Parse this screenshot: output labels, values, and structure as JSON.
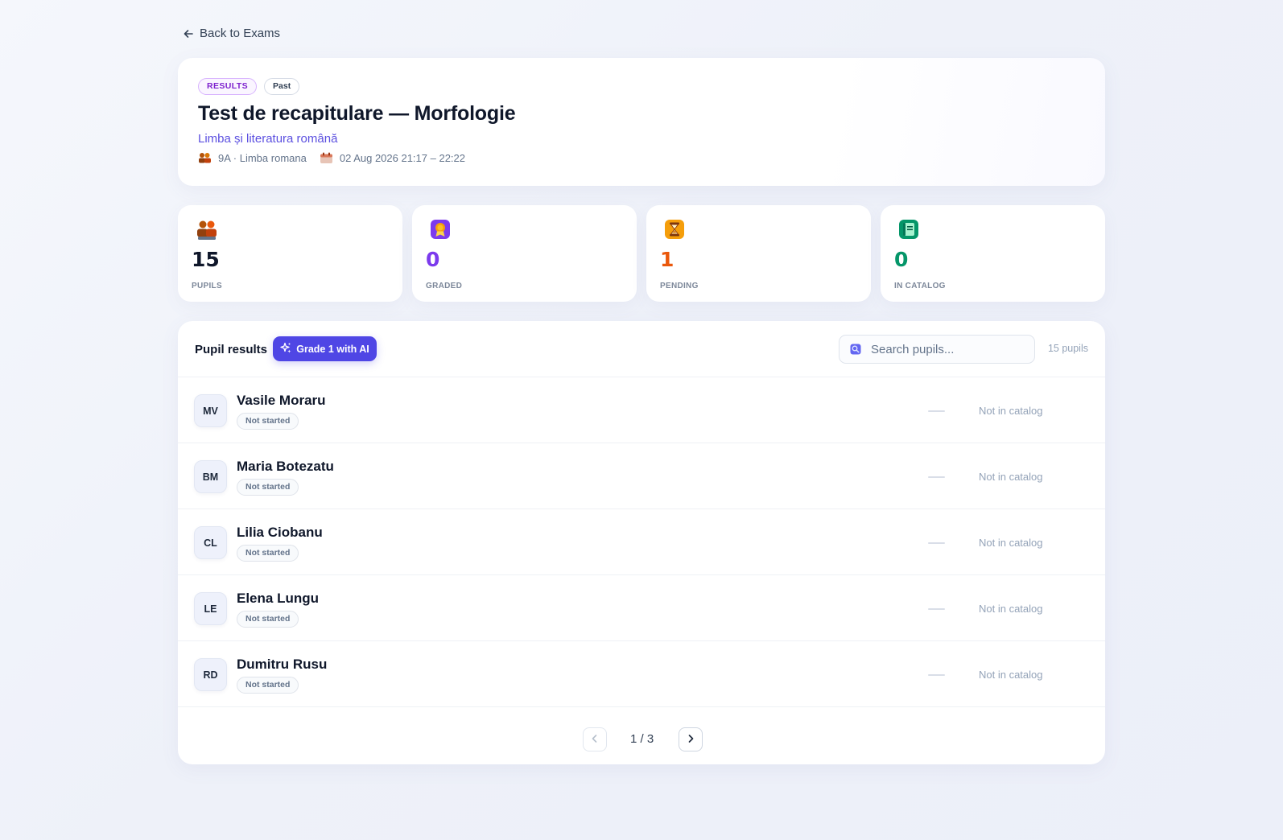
{
  "nav": {
    "back_label": "Back to Exams"
  },
  "exam": {
    "badges": {
      "results": "RESULTS",
      "past": "Past"
    },
    "title": "Test de recapitulare — Morfologie",
    "subject": "Limba și literatura română",
    "class_info": "9A · Limba romana",
    "schedule": "02 Aug 2026 21:17 – 22:22"
  },
  "stats": [
    {
      "value": "15",
      "label": "PUPILS",
      "icon": "pupils-icon",
      "color": "#0f172a"
    },
    {
      "value": "0",
      "label": "GRADED",
      "icon": "medal-icon",
      "color": "#7c3aed"
    },
    {
      "value": "1",
      "label": "PENDING",
      "icon": "hourglass-icon",
      "color": "#ea580c"
    },
    {
      "value": "0",
      "label": "IN CATALOG",
      "icon": "catalog-book-icon",
      "color": "#059669"
    }
  ],
  "results": {
    "title": "Pupil results",
    "ai_button_label": "Grade 1 with AI",
    "search_placeholder": "Search pupils...",
    "count_label": "15 pupils",
    "pupils": [
      {
        "initials": "MV",
        "name": "Vasile Moraru",
        "status": "Not started",
        "grade": "—",
        "catalog": "Not in catalog"
      },
      {
        "initials": "BM",
        "name": "Maria Botezatu",
        "status": "Not started",
        "grade": "—",
        "catalog": "Not in catalog"
      },
      {
        "initials": "CL",
        "name": "Lilia Ciobanu",
        "status": "Not started",
        "grade": "—",
        "catalog": "Not in catalog"
      },
      {
        "initials": "LE",
        "name": "Elena Lungu",
        "status": "Not started",
        "grade": "—",
        "catalog": "Not in catalog"
      },
      {
        "initials": "RD",
        "name": "Dumitru Rusu",
        "status": "Not started",
        "grade": "—",
        "catalog": "Not in catalog"
      }
    ],
    "pagination": {
      "label": "1 / 3"
    }
  },
  "colors": {
    "accent": "#4f46e5",
    "subject": "#5b4fe0",
    "results_badge": "#7e22ce"
  }
}
